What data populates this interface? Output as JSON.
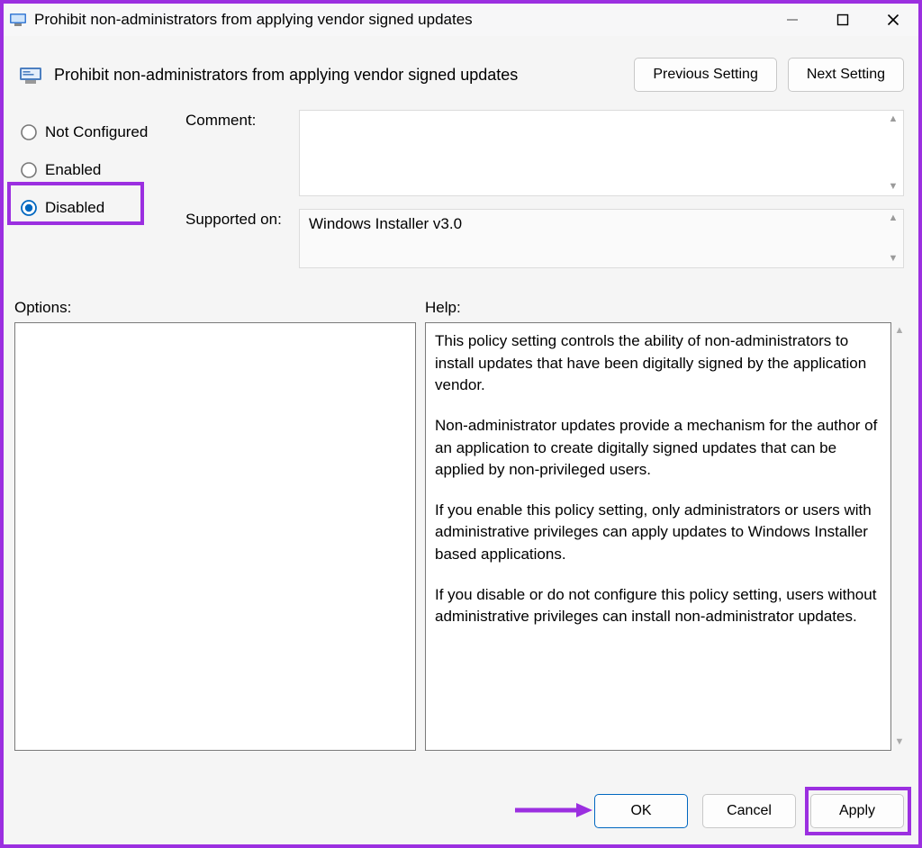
{
  "window": {
    "title": "Prohibit non-administrators from applying vendor signed updates"
  },
  "header": {
    "title": "Prohibit non-administrators from applying vendor signed updates",
    "prev": "Previous Setting",
    "next": "Next Setting"
  },
  "radios": {
    "not_configured": "Not Configured",
    "enabled": "Enabled",
    "disabled": "Disabled",
    "selected": "disabled"
  },
  "form": {
    "comment_label": "Comment:",
    "comment_value": "",
    "supported_label": "Supported on:",
    "supported_value": "Windows Installer v3.0"
  },
  "pane_labels": {
    "options": "Options:",
    "help": "Help:"
  },
  "help": {
    "p1": "This policy setting controls the ability of non-administrators to install updates that have been digitally signed by the application vendor.",
    "p2": "Non-administrator updates provide a mechanism for the author of an application to create digitally signed updates that can be applied by non-privileged users.",
    "p3": "If you enable this policy setting, only administrators or users with administrative privileges can apply updates to Windows Installer based applications.",
    "p4": "If you disable or do not configure this policy setting, users without administrative privileges can install non-administrator updates."
  },
  "footer": {
    "ok": "OK",
    "cancel": "Cancel",
    "apply": "Apply"
  }
}
